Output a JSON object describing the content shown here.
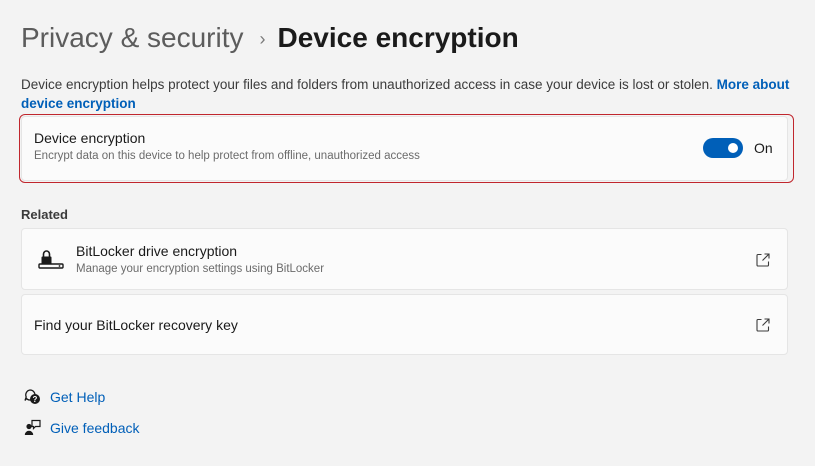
{
  "breadcrumb": {
    "parent": "Privacy & security",
    "separator": "›",
    "current": "Device encryption"
  },
  "description": {
    "text": "Device encryption helps protect your files and folders from unauthorized access in case your device is lost or stolen.",
    "link": "More about device encryption"
  },
  "encryption_card": {
    "title": "Device encryption",
    "subtitle": "Encrypt data on this device to help protect from offline, unauthorized access",
    "toggle_on": true,
    "toggle_label": "On"
  },
  "related": {
    "label": "Related",
    "items": [
      {
        "title": "BitLocker drive encryption",
        "subtitle": "Manage your encryption settings using BitLocker",
        "icon": "bitlocker-drive-icon",
        "action_icon": "open-external-icon"
      },
      {
        "title": "Find your BitLocker recovery key",
        "action_icon": "open-external-icon"
      }
    ]
  },
  "footer": {
    "get_help": "Get Help",
    "get_help_icon": "help-chat-icon",
    "give_feedback": "Give feedback",
    "give_feedback_icon": "feedback-icon"
  },
  "colors": {
    "accent": "#005fb8",
    "focus_outline": "#c0262d",
    "background": "#f3f3f3",
    "card": "#fbfbfb"
  }
}
